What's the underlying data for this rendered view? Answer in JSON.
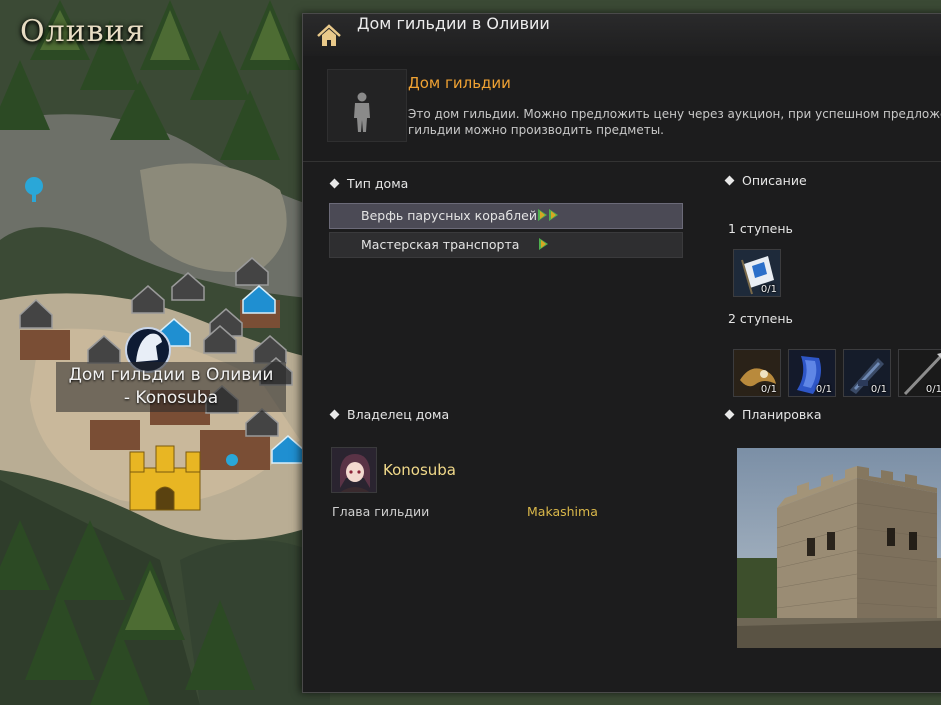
{
  "map": {
    "region_title": "Оливия",
    "house_label_line1": "Дом гильдии в Оливии",
    "house_label_line2": "- Konosuba"
  },
  "panel": {
    "title": "Дом гильдии в Оливии",
    "info": {
      "name": "Дом гильдии",
      "description_line1": "Это дом гильдии. Можно предложить цену через аукцион, при успешном предложе",
      "description_line2": "гильдии можно производить предметы."
    },
    "house_type": {
      "title": "Тип дома",
      "items": [
        {
          "label": "Верфь парусных кораблей",
          "selected": true
        },
        {
          "label": "Мастерская транспорта",
          "selected": false
        }
      ]
    },
    "description": {
      "title": "Описание",
      "step1_label": "1 ступень",
      "step1_items": [
        {
          "icon": "flag-banner-icon",
          "count": "0/1"
        }
      ],
      "step2_label": "2 ступень",
      "step2_items": [
        {
          "icon": "figurehead-icon",
          "count": "0/1"
        },
        {
          "icon": "blue-sail-icon",
          "count": "0/1"
        },
        {
          "icon": "cannon-icon",
          "count": "0/1"
        },
        {
          "icon": "harpoon-icon",
          "count": "0/1"
        }
      ]
    },
    "owner": {
      "title": "Владелец дома",
      "guild_name": "Konosuba",
      "leader_label": "Глава гильдии",
      "leader_value": "Makashima"
    },
    "layout": {
      "title": "Планировка"
    }
  },
  "colors": {
    "accent_orange": "#f0a233",
    "guild_gold": "#f1d98a",
    "leader_gold": "#d9b74a",
    "selected_row": "#4b4a55"
  }
}
